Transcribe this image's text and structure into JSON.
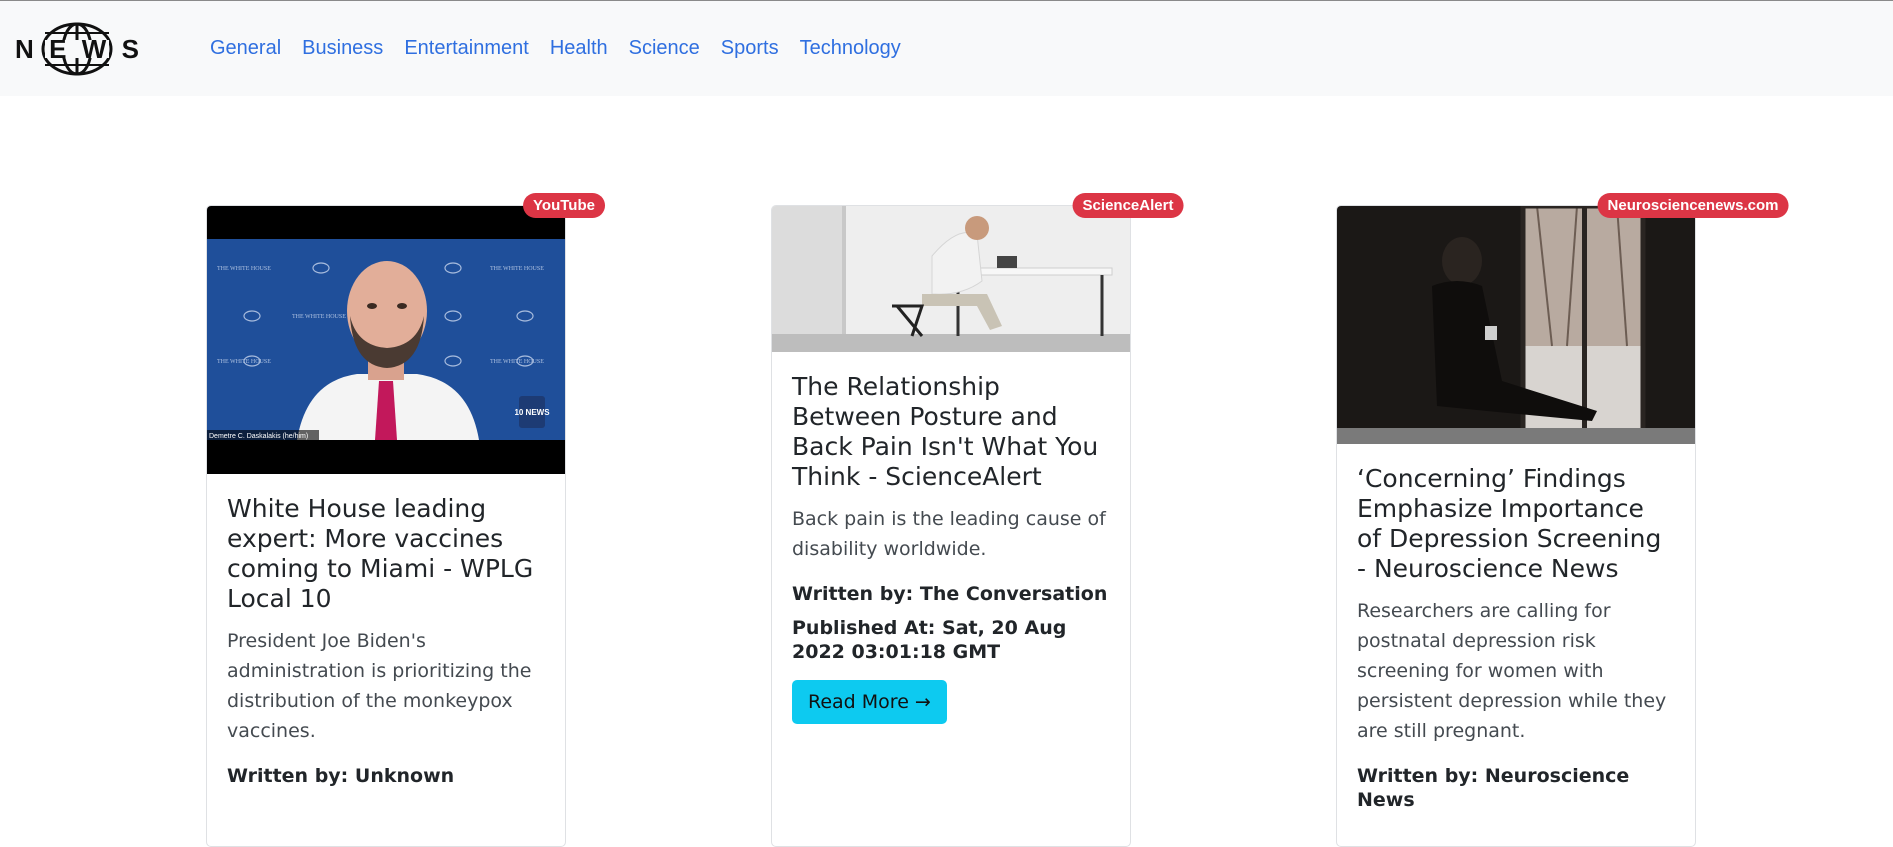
{
  "navbar": {
    "logo_text": "NEWS",
    "links": [
      "General",
      "Business",
      "Entertainment",
      "Health",
      "Science",
      "Sports",
      "Technology"
    ]
  },
  "articles": [
    {
      "source": "YouTube",
      "title": "White House leading expert: More vaccines coming to Miami - WPLG Local 10",
      "description": "President Joe Biden's administration is prioritizing the distribution of the monkeypox vaccines.",
      "author": "Written by: Unknown"
    },
    {
      "source": "ScienceAlert",
      "title": "The Relationship Between Posture and Back Pain Isn't What You Think - ScienceAlert",
      "description": "Back pain is the leading cause of disability worldwide.",
      "author": "Written by: The Conversation",
      "published": "Published At: Sat, 20 Aug 2022 03:01:18 GMT",
      "button": "Read More →"
    },
    {
      "source": "Neurosciencenews.com",
      "title": "‘Concerning’ Findings Emphasize Importance of Depression Screening - Neuroscience News",
      "description": "Researchers are calling for postnatal depression risk screening for women with persistent depression while they are still pregnant.",
      "author": "Written by: Neuroscience News"
    }
  ],
  "image_overlays": {
    "video_caption": "Demetre C. Daskalakis (he/him)",
    "backdrop_text": "THE WHITE HOUSE",
    "channel_logo": "10 NEWS"
  }
}
